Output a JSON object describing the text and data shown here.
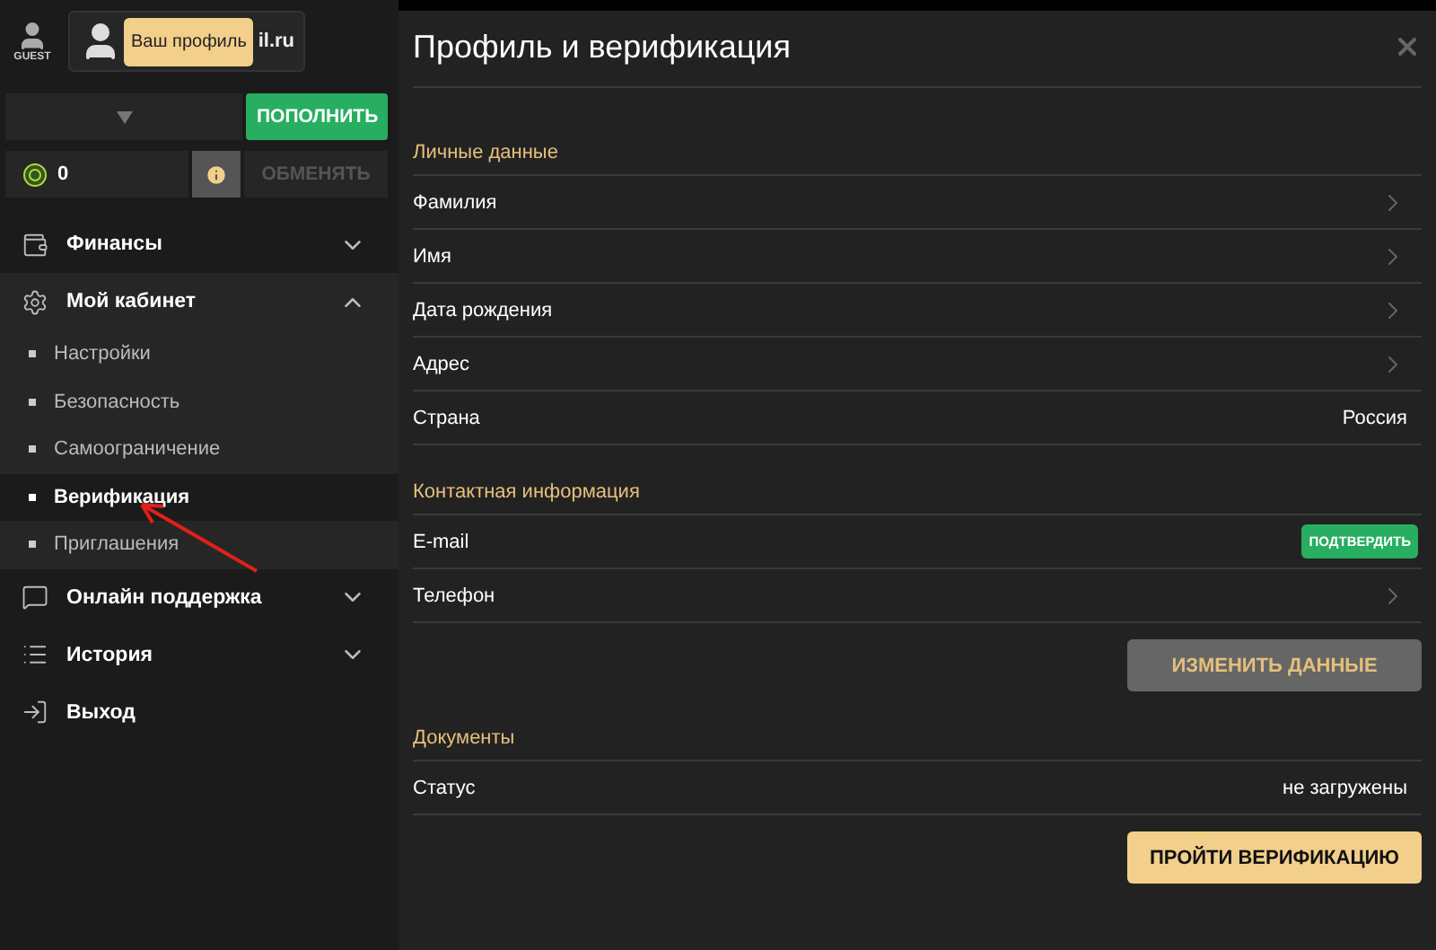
{
  "sidebar": {
    "guest_label": "GUEST",
    "profile_text": "il.ru",
    "tooltip": "Ваш профиль",
    "deposit_button": "ПОПОЛНИТЬ",
    "points": "0",
    "exchange_button": {
      "label": "ОБМЕНЯТЬ",
      "disabled": true
    },
    "menu": [
      {
        "kind": "wallet",
        "label": "Финансы",
        "expanded": false
      },
      {
        "kind": "settings",
        "label": "Мой кабинет",
        "expanded": true,
        "children": [
          {
            "label": "Настройки",
            "selected": false
          },
          {
            "label": "Безопасность",
            "selected": false
          },
          {
            "label": "Самоограничение",
            "selected": false
          },
          {
            "label": "Верификация",
            "selected": true
          },
          {
            "label": "Приглашения",
            "selected": false
          }
        ]
      },
      {
        "kind": "chat",
        "label": "Онлайн поддержка",
        "expanded": false
      },
      {
        "kind": "list",
        "label": "История",
        "expanded": false
      },
      {
        "kind": "exit",
        "label": "Выход"
      }
    ]
  },
  "panel": {
    "title": "Профиль и верификация",
    "sections": [
      {
        "title": "Личные данные",
        "rows": [
          {
            "kind": "link",
            "label": "Фамилия"
          },
          {
            "kind": "link",
            "label": "Имя"
          },
          {
            "kind": "link",
            "label": "Дата рождения"
          },
          {
            "kind": "link",
            "label": "Адрес"
          },
          {
            "kind": "value",
            "label": "Страна",
            "value": "Россия"
          }
        ]
      },
      {
        "title": "Контактная информация",
        "rows": [
          {
            "kind": "action",
            "label": "E-mail",
            "value": "ПОДТВЕРДИТЬ"
          },
          {
            "kind": "link",
            "label": "Телефон"
          }
        ],
        "button": {
          "label": "ИЗМЕНИТЬ ДАННЫЕ",
          "primary": false
        }
      },
      {
        "title": "Документы",
        "rows": [
          {
            "kind": "value",
            "label": "Статус",
            "value": "не загружены"
          }
        ],
        "button": {
          "label": "ПРОЙТИ ВЕРИФИКАЦИЮ",
          "primary": true
        }
      }
    ]
  }
}
